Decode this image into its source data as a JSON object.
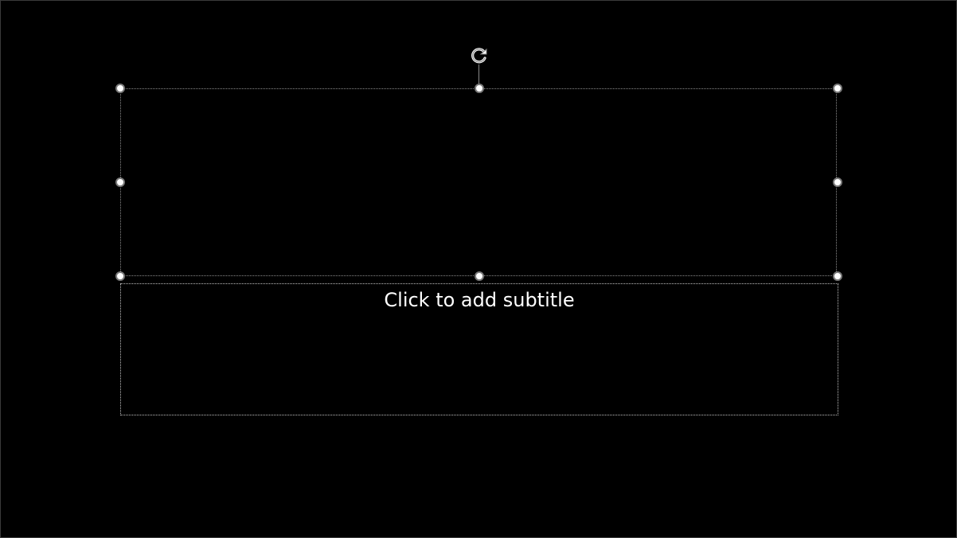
{
  "slide": {
    "subtitle_placeholder": "Click to add subtitle",
    "background_color": "#000000",
    "text_color": "#ffffff"
  },
  "selection": {
    "handle_color": "#ffffff",
    "handle_border_color": "#7a7a7a",
    "rotate_icon": "rotate-icon"
  }
}
